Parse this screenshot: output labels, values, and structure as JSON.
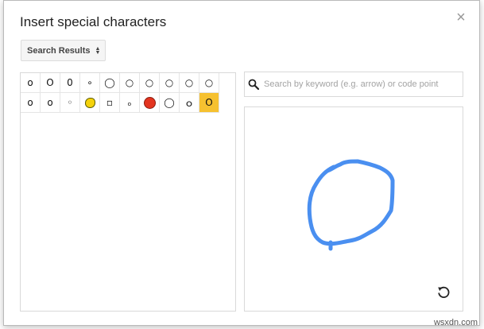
{
  "dialog": {
    "title": "Insert special characters",
    "close_icon": "close-icon",
    "close_glyph": "×"
  },
  "category_select": {
    "selected": "Search Results"
  },
  "results": [
    [
      "o",
      "O",
      "0",
      "∘",
      "◯",
      "○",
      "○",
      "○",
      "○",
      "○"
    ],
    [
      "o",
      "о",
      "◦",
      "lemon",
      "▫",
      "ₒ",
      "red-circle",
      "◯",
      "ｏ",
      "O"
    ]
  ],
  "selected_result": {
    "row": 1,
    "col": 9
  },
  "search": {
    "placeholder": "Search by keyword (e.g. arrow) or code point",
    "value": "",
    "icon": "search-icon"
  },
  "drawing": {
    "stroke_color": "#4a8ff0",
    "reset_icon": "undo-icon"
  },
  "watermark": "wsxdn.com"
}
